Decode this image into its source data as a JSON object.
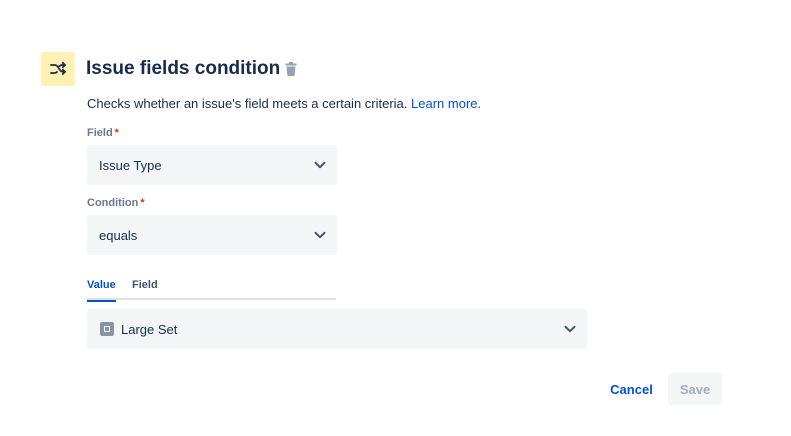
{
  "header": {
    "title": "Issue fields condition",
    "icon": "shuffle-icon",
    "icon_bg": "#fff0b3",
    "delete_icon": "trash-icon"
  },
  "description": {
    "text": "Checks whether an issue's field meets a certain criteria.",
    "link_text": "Learn more."
  },
  "field": {
    "label": "Field",
    "required_mark": "*",
    "value": "Issue Type"
  },
  "condition": {
    "label": "Condition",
    "required_mark": "*",
    "value": "equals"
  },
  "tabs": [
    {
      "label": "Value",
      "active": true
    },
    {
      "label": "Field",
      "active": false
    }
  ],
  "value_select": {
    "value": "Large Set",
    "icon": "issue-type-icon"
  },
  "footer": {
    "cancel_label": "Cancel",
    "save_label": "Save"
  },
  "colors": {
    "accent": "#0052cc",
    "text": "#172b4d",
    "subtle": "#6b778c",
    "required": "#de350b",
    "field_bg": "#f4f5f7",
    "disabled_text": "#a5adba"
  }
}
